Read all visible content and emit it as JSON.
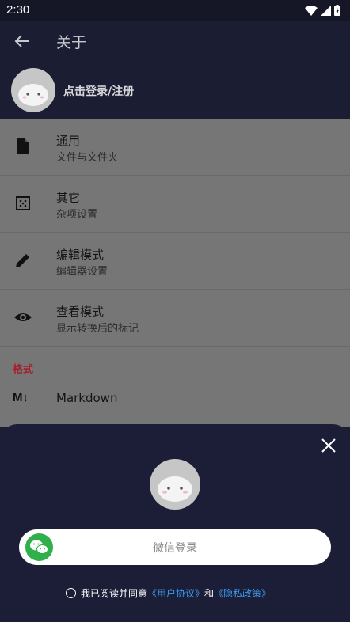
{
  "status": {
    "time": "2:30"
  },
  "appbar": {
    "title": "关于"
  },
  "profile": {
    "login_text": "点击登录/注册"
  },
  "settings": {
    "items": [
      {
        "title": "通用",
        "subtitle": "文件与文件夹",
        "icon": "file-icon"
      },
      {
        "title": "其它",
        "subtitle": "杂项设置",
        "icon": "grid-dots-icon"
      },
      {
        "title": "编辑模式",
        "subtitle": "编辑器设置",
        "icon": "pencil-icon"
      },
      {
        "title": "查看模式",
        "subtitle": "显示转换后的标记",
        "icon": "eye-icon"
      }
    ],
    "section": "格式",
    "markdown": {
      "icon_text": "M↓",
      "label": "Markdown"
    }
  },
  "sheet": {
    "wechat_login": "微信登录",
    "agree_prefix": "我已阅读并同意",
    "user_agreement": "《用户协议》",
    "and": "和",
    "privacy_policy": "《隐私政策》"
  },
  "colors": {
    "accent_link": "#3b9cf2",
    "wechat_green": "#2fb04a",
    "section_red": "#a51f2a",
    "sheet_bg": "#1c1e38"
  }
}
